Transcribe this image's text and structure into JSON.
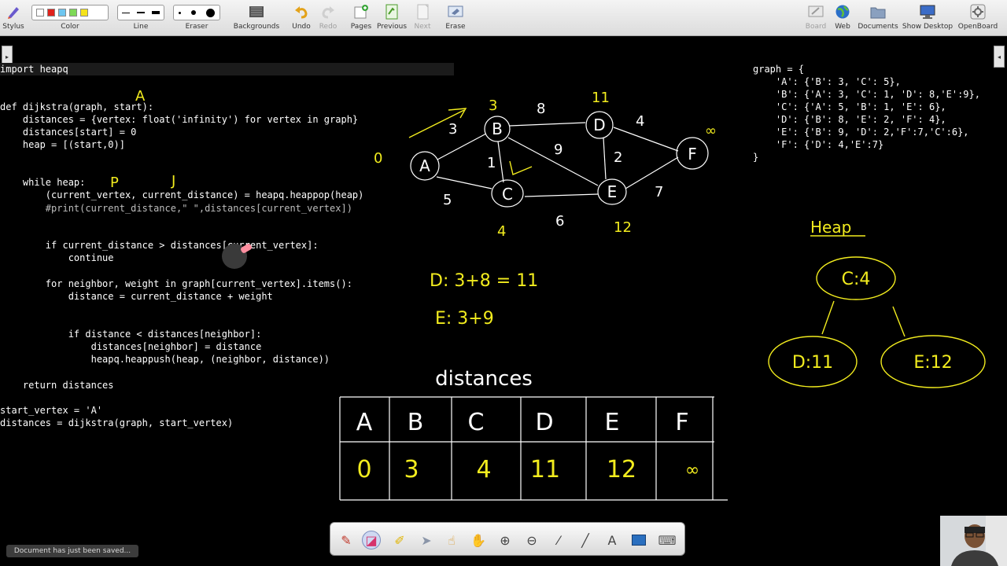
{
  "toolbar": {
    "stylus": "Stylus",
    "color": "Color",
    "line": "Line",
    "eraser": "Eraser",
    "backgrounds": "Backgrounds",
    "undo": "Undo",
    "redo": "Redo",
    "pages": "Pages",
    "previous": "Previous",
    "next": "Next",
    "erase": "Erase",
    "board": "Board",
    "web": "Web",
    "documents": "Documents",
    "show_desktop": "Show Desktop",
    "openboard": "OpenBoard",
    "color_swatches": [
      "#ffffff",
      "#e0211b",
      "#6ec6f0",
      "#7ed957",
      "#f5e31b"
    ]
  },
  "code": {
    "lines": [
      "import heapq",
      "def dijkstra(graph, start):",
      "    distances = {vertex: float('infinity') for vertex in graph}",
      "    distances[start] = 0",
      "    heap = [(start,0)]",
      "    while heap:",
      "        (current_vertex, current_distance) = heapq.heappop(heap)",
      "        #print(current_distance,\" \",distances[current_vertex])",
      "        if current_distance > distances[current_vertex]:",
      "            continue",
      "        for neighbor, weight in graph[current_vertex].items():",
      "            distance = current_distance + weight",
      "            if distance < distances[neighbor]:",
      "                distances[neighbor] = distance",
      "                heapq.heappush(heap, (neighbor, distance))",
      "    return distances",
      "start_vertex = 'A'",
      "distances = dijkstra(graph, start_vertex)"
    ],
    "graph_dict": [
      "graph = {",
      "    'A': {'B': 3, 'C': 5},",
      "    'B': {'A': 3, 'C': 1, 'D': 8,'E':9},",
      "    'C': {'A': 5, 'B': 1, 'E': 6},",
      "    'D': {'B': 8, 'E': 2, 'F': 4},",
      "    'E': {'B': 9, 'D': 2,'F':7,'C':6},",
      "    'F': {'D': 4,'E':7}",
      "}"
    ]
  },
  "annotations": {
    "graph_nodes": [
      "A",
      "B",
      "C",
      "D",
      "E",
      "F"
    ],
    "edge_weights": [
      "3",
      "5",
      "1",
      "9",
      "8",
      "4",
      "2",
      "6",
      "7"
    ],
    "node_distances": [
      "0",
      "3",
      "4",
      "11",
      "12",
      "∞"
    ],
    "dist_note_1": "D: 3+8 = 11",
    "dist_note_2": "E: 3+9",
    "while_note_1": "P",
    "while_note_2": "J",
    "a_note": "A",
    "distances_title": "distances",
    "heap_title": "Heap",
    "heap_nodes": [
      "C:4",
      "D:11",
      "E:12"
    ],
    "table_headers": [
      "A",
      "B",
      "C",
      "D",
      "E",
      "F"
    ],
    "table_values": [
      "0",
      "3",
      "4",
      "11",
      "12",
      "∞"
    ]
  },
  "status": "Document has just been saved..."
}
